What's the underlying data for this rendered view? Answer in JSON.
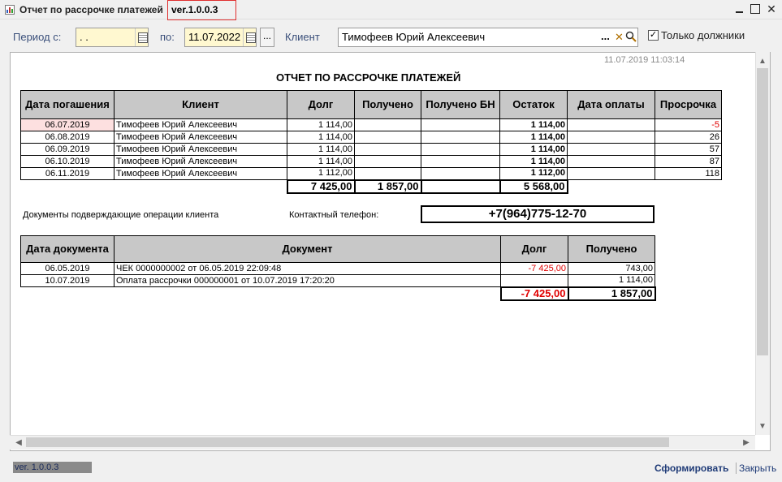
{
  "window": {
    "title": "Отчет  по рассрочке платежей",
    "version": "ver.1.0.0.3"
  },
  "toolbar": {
    "period_from_label": "Период с:",
    "period_from_value": " . .",
    "period_to_label": "по:",
    "period_to_value": "11.07.2022",
    "ellipsis": "...",
    "client_label": "Клиент",
    "client_value": "Тимофеев Юрий Алексеевич",
    "only_debtors_label": "Только должники",
    "only_debtors_checked": true
  },
  "report": {
    "datetime": "11.07.2019 11:03:14",
    "title": "ОТЧЕТ ПО РАССРОЧКЕ ПЛАТЕЖЕЙ",
    "schedule": {
      "headers": {
        "due_date": "Дата погашения",
        "client": "Клиент",
        "debt": "Долг",
        "received": "Получено",
        "received_bn": "Получено БН",
        "balance": "Остаток",
        "pay_date": "Дата оплаты",
        "overdue": "Просрочка"
      },
      "rows": [
        {
          "due_date": "06.07.2019",
          "client": "Тимофеев Юрий Алексеевич",
          "debt": "1 114,00",
          "received": "",
          "received_bn": "",
          "balance": "1 114,00",
          "pay_date": "",
          "overdue": "-5"
        },
        {
          "due_date": "06.08.2019",
          "client": "Тимофеев Юрий Алексеевич",
          "debt": "1 114,00",
          "received": "",
          "received_bn": "",
          "balance": "1 114,00",
          "pay_date": "",
          "overdue": "26"
        },
        {
          "due_date": "06.09.2019",
          "client": "Тимофеев Юрий Алексеевич",
          "debt": "1 114,00",
          "received": "",
          "received_bn": "",
          "balance": "1 114,00",
          "pay_date": "",
          "overdue": "57"
        },
        {
          "due_date": "06.10.2019",
          "client": "Тимофеев Юрий Алексеевич",
          "debt": "1 114,00",
          "received": "",
          "received_bn": "",
          "balance": "1 114,00",
          "pay_date": "",
          "overdue": "87"
        },
        {
          "due_date": "06.11.2019",
          "client": "Тимофеев Юрий Алексеевич",
          "debt": "1 112,00",
          "received": "",
          "received_bn": "",
          "balance": "1 112,00",
          "pay_date": "",
          "overdue": "118"
        }
      ],
      "totals": {
        "debt": "7 425,00",
        "received": "1 857,00",
        "received_bn": "",
        "balance": "5 568,00"
      }
    },
    "docs_label": "Документы подверждающие операции клиента",
    "phone_label": "Контактный телефон:",
    "phone_value": "+7(964)775-12-70",
    "documents": {
      "headers": {
        "date": "Дата документа",
        "document": "Документ",
        "debt": "Долг",
        "received": "Получено"
      },
      "rows": [
        {
          "date": "06.05.2019",
          "document": "ЧЕК 0000000002 от 06.05.2019 22:09:48",
          "debt": "-7 425,00",
          "received": "743,00"
        },
        {
          "date": "10.07.2019",
          "document": "Оплата рассрочки 000000001 от 10.07.2019 17:20:20",
          "debt": "",
          "received": "1 114,00"
        }
      ],
      "totals": {
        "debt": "-7 425,00",
        "received": "1 857,00"
      }
    }
  },
  "footer": {
    "version": "ver. 1.0.0.3",
    "form_button": "Сформировать",
    "close_button": "Закрыть"
  },
  "icons": [
    "app-icon",
    "minimize-icon",
    "maximize-icon",
    "close-icon",
    "calendar-icon",
    "clear-icon",
    "search-icon"
  ]
}
